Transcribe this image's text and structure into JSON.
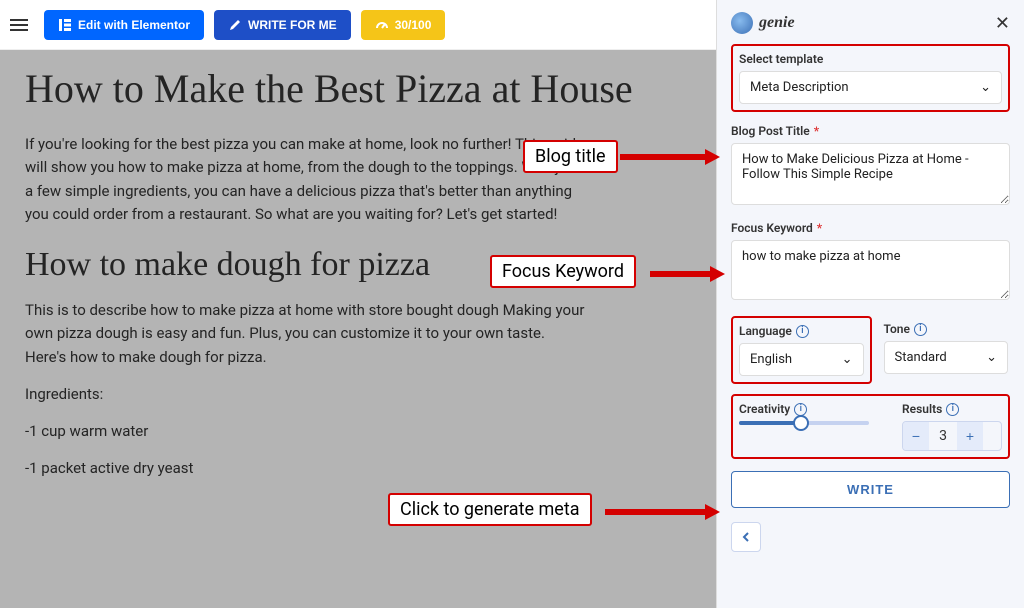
{
  "topbar": {
    "elementor_label": "Edit with Elementor",
    "write_for_me_label": "WRITE FOR ME",
    "credits_label": "30/100"
  },
  "post": {
    "title": "How to Make the Best Pizza at House",
    "intro": "If you're looking for the best pizza you can make at home, look no further! This guide will show you how to make pizza at home, from the dough to the toppings. With just a few simple ingredients, you can have a delicious pizza that's better than anything you could order from a restaurant. So what are you waiting for? Let's get started!",
    "section2_title": "How to make dough for pizza",
    "section2_body": "This is to describe how to make pizza at home with store bought dough Making your own pizza dough is easy and fun. Plus, you can customize it to your own taste. Here's how to make dough for pizza.",
    "ingredients_label": "Ingredients:",
    "ing1": "-1 cup warm water",
    "ing2": "-1 packet active dry yeast"
  },
  "panel": {
    "brand": "genie",
    "template_label": "Select template",
    "template_value": "Meta Description",
    "blog_title_label": "Blog Post Title",
    "blog_title_value": "How to Make Delicious Pizza at Home - Follow This Simple Recipe",
    "keyword_label": "Focus Keyword",
    "keyword_value": "how to make pizza at home",
    "language_label": "Language",
    "language_value": "English",
    "tone_label": "Tone",
    "tone_value": "Standard",
    "creativity_label": "Creativity",
    "results_label": "Results",
    "results_value": "3",
    "write_btn": "WRITE"
  },
  "callouts": {
    "blog_title": "Blog title",
    "focus_keyword": "Focus Keyword",
    "generate": "Click to generate meta"
  }
}
